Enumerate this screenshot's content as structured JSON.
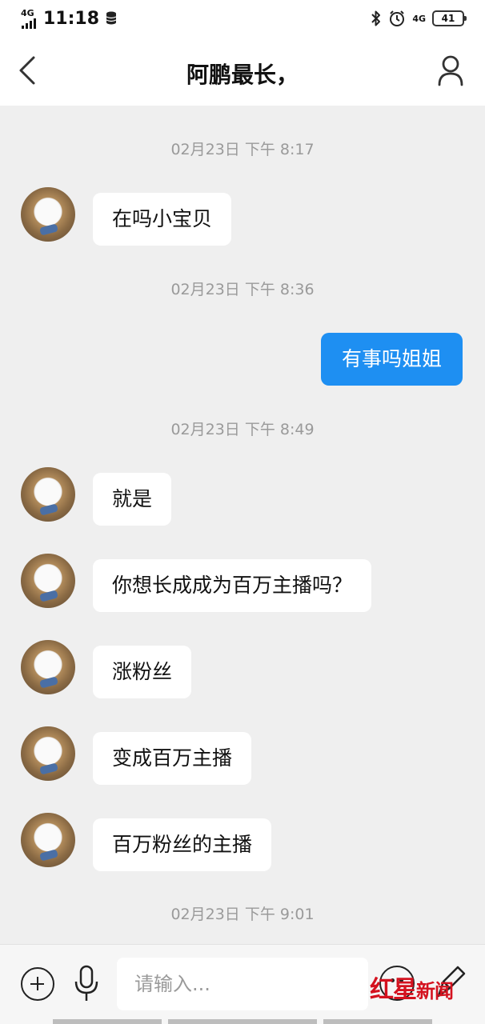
{
  "status_bar": {
    "network": "4G",
    "time": "11:18",
    "network_right": "4G",
    "battery": "41"
  },
  "header": {
    "title": "阿鹏最长，"
  },
  "messages": [
    {
      "type": "time",
      "text": "02月23日 下午 8:17"
    },
    {
      "type": "in",
      "text": "在吗小宝贝"
    },
    {
      "type": "time",
      "text": "02月23日 下午 8:36"
    },
    {
      "type": "out",
      "text": "有事吗姐姐"
    },
    {
      "type": "time",
      "text": "02月23日 下午 8:49"
    },
    {
      "type": "in",
      "text": "就是"
    },
    {
      "type": "in",
      "text": "你想长成成为百万主播吗？"
    },
    {
      "type": "in",
      "text": "涨粉丝"
    },
    {
      "type": "in",
      "text": "变成百万主播"
    },
    {
      "type": "in",
      "text": "百万粉丝的主播"
    },
    {
      "type": "time",
      "text": "02月23日 下午 9:01"
    }
  ],
  "input_bar": {
    "placeholder": "请输入..."
  },
  "watermark": {
    "brand": "红星",
    "label": "新闻"
  },
  "colors": {
    "outgoing_bubble": "#1e8ff2",
    "incoming_bubble": "#ffffff",
    "background": "#efefef",
    "watermark": "#d4121f"
  }
}
